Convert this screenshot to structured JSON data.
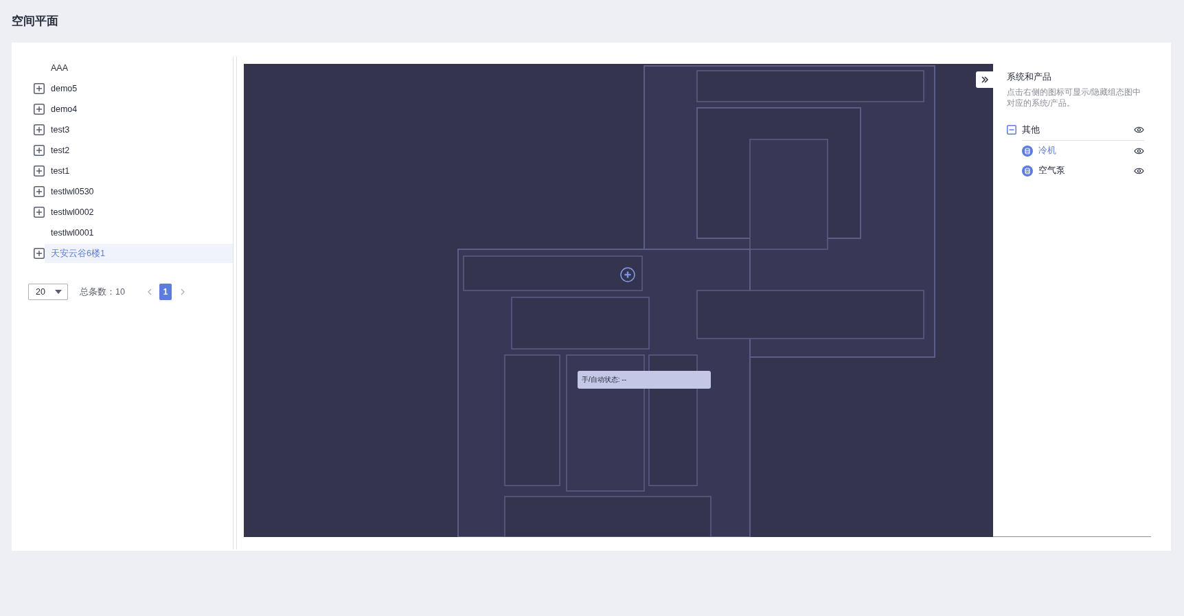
{
  "page": {
    "title": "空间平面"
  },
  "tree": {
    "items": [
      {
        "label": "AAA",
        "expandable": false,
        "selected": false
      },
      {
        "label": "demo5",
        "expandable": true,
        "selected": false
      },
      {
        "label": "demo4",
        "expandable": true,
        "selected": false
      },
      {
        "label": "test3",
        "expandable": true,
        "selected": false
      },
      {
        "label": "test2",
        "expandable": true,
        "selected": false
      },
      {
        "label": "test1",
        "expandable": true,
        "selected": false
      },
      {
        "label": "testlwl0530",
        "expandable": true,
        "selected": false
      },
      {
        "label": "testlwl0002",
        "expandable": true,
        "selected": false
      },
      {
        "label": "testlwl0001",
        "expandable": false,
        "selected": false
      },
      {
        "label": "天安云谷6楼1",
        "expandable": true,
        "selected": true
      }
    ],
    "pagination": {
      "page_size": "20",
      "total": "总条数：10",
      "pages": [
        {
          "label": "1",
          "selected": true
        }
      ]
    }
  },
  "floor_plan": {
    "kind": "picture",
    "tooltip": "手/自动状态: --"
  },
  "side_panel": {
    "title": "系统和产品",
    "description": "点击右侧的图标可显示/隐藏组态图中对应的系统/产品。",
    "groups": [
      {
        "label": "其他",
        "expanded": true,
        "children": [
          {
            "label": "冷机",
            "selected": true
          },
          {
            "label": "空气泵",
            "selected": false
          }
        ]
      }
    ]
  }
}
